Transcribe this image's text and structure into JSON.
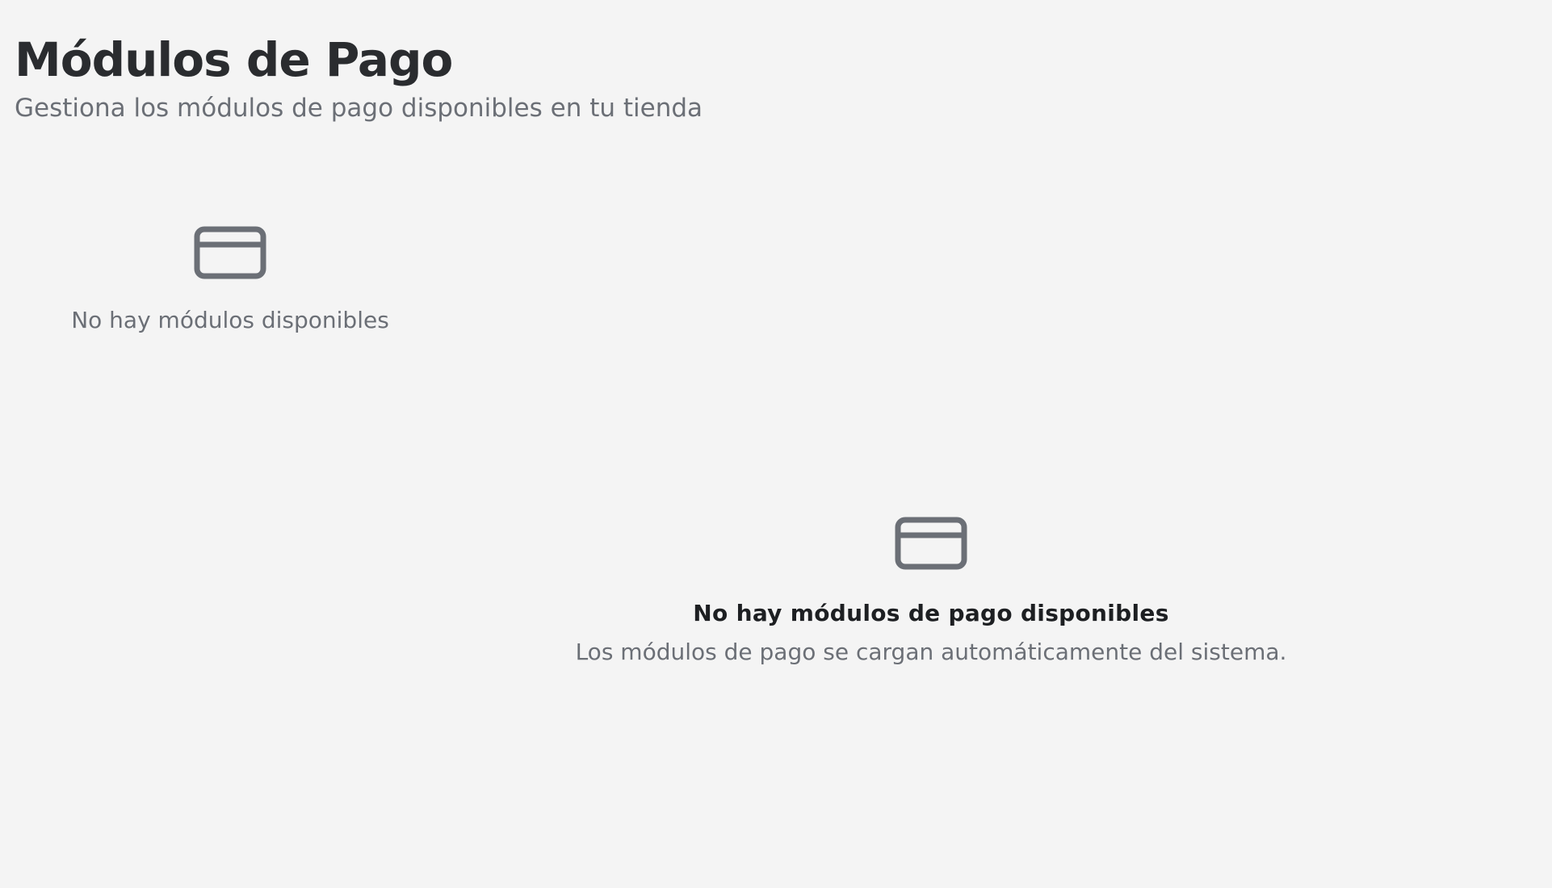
{
  "header": {
    "title": "Módulos de Pago",
    "subtitle": "Gestiona los módulos de pago disponibles en tu tienda"
  },
  "sidebar": {
    "icon": "credit-card-icon",
    "empty_text": "No hay módulos disponibles"
  },
  "main": {
    "icon": "credit-card-icon",
    "empty_title": "No hay módulos de pago disponibles",
    "empty_description": "Los módulos de pago se cargan automáticamente del sistema."
  },
  "colors": {
    "background": "#f4f4f4",
    "title": "#2a2c2f",
    "muted": "#6b6f76",
    "icon": "#6b6f76",
    "empty_title": "#1d1f22"
  }
}
